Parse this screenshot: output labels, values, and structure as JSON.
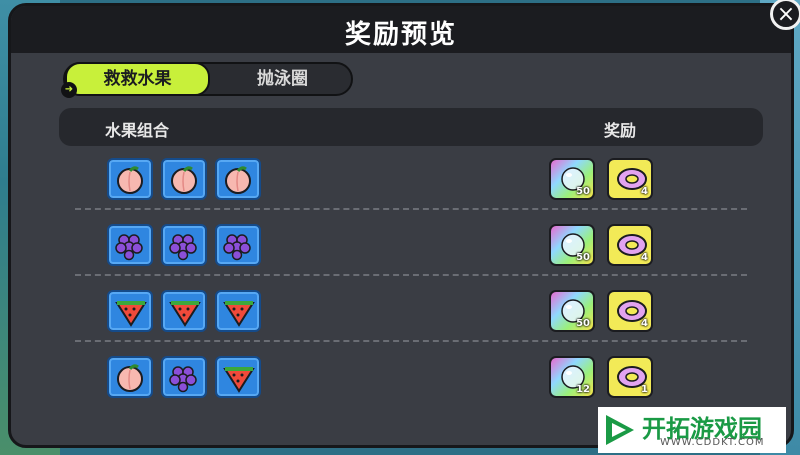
{
  "title": "奖励预览",
  "tabs": [
    {
      "label": "救救水果",
      "active": true
    },
    {
      "label": "抛泳圈",
      "active": false
    }
  ],
  "columns": {
    "combo": "水果组合",
    "reward": "奖励"
  },
  "rows": [
    {
      "fruits": [
        "peach-icon",
        "peach-icon",
        "peach-icon"
      ],
      "rewards": [
        {
          "icon": "bubble-icon",
          "count": "50"
        },
        {
          "icon": "swim-ring-icon",
          "count": "4"
        }
      ]
    },
    {
      "fruits": [
        "grape-icon",
        "grape-icon",
        "grape-icon"
      ],
      "rewards": [
        {
          "icon": "bubble-icon",
          "count": "50"
        },
        {
          "icon": "swim-ring-icon",
          "count": "4"
        }
      ]
    },
    {
      "fruits": [
        "watermelon-icon",
        "watermelon-icon",
        "watermelon-icon"
      ],
      "rewards": [
        {
          "icon": "bubble-icon",
          "count": "50"
        },
        {
          "icon": "swim-ring-icon",
          "count": "4"
        }
      ]
    },
    {
      "fruits": [
        "peach-icon",
        "grape-icon",
        "watermelon-icon"
      ],
      "rewards": [
        {
          "icon": "bubble-icon",
          "count": "12"
        },
        {
          "icon": "swim-ring-icon",
          "count": "1"
        }
      ]
    }
  ],
  "watermark": {
    "title": "开拓游戏园",
    "url": "WWW.CDDKT.COM"
  },
  "colors": {
    "accent": "#c8f03a",
    "panel": "#3a3d44",
    "tile": "#2f86e0"
  }
}
